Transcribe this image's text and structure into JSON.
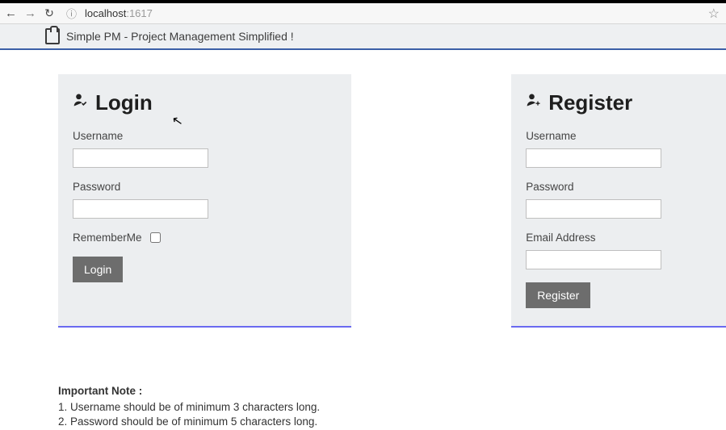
{
  "browser": {
    "url_host": "localhost",
    "url_port": ":1617"
  },
  "app": {
    "title": "Simple PM - Project Management Simplified !"
  },
  "login": {
    "heading": "Login",
    "username_label": "Username",
    "username_value": "",
    "password_label": "Password",
    "password_value": "",
    "remember_label": "RememberMe",
    "button_label": "Login"
  },
  "register": {
    "heading": "Register",
    "username_label": "Username",
    "username_value": "",
    "password_label": "Password",
    "password_value": "",
    "email_label": "Email Address",
    "email_value": "",
    "button_label": "Register"
  },
  "note": {
    "title": "Important Note :",
    "line1": "1. Username should be of minimum 3 characters long.",
    "line2": "2. Password should be of minimum 5 characters long."
  }
}
